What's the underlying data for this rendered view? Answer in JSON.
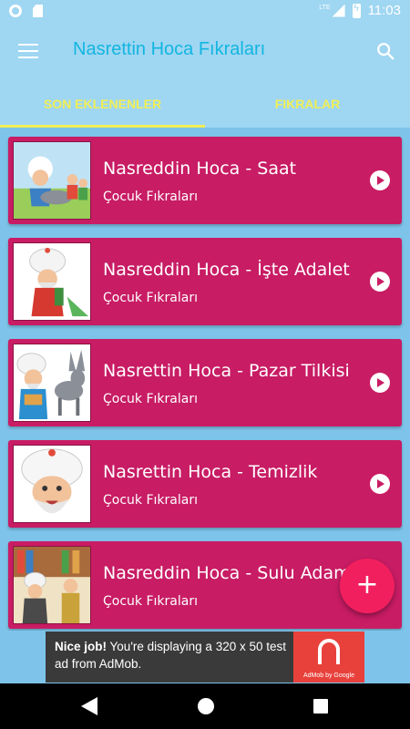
{
  "status_bar": {
    "network_label": "LTE",
    "time": "11:03"
  },
  "app_bar": {
    "title": "Nasrettin Hoca Fıkraları"
  },
  "tabs": [
    {
      "label": "SON EKLENENLER",
      "active": true
    },
    {
      "label": "FIKRALAR",
      "active": false
    }
  ],
  "items": [
    {
      "title": "Nasreddin Hoca - Saat",
      "category": "Çocuk Fıkraları"
    },
    {
      "title": "Nasreddin Hoca - İşte Adalet",
      "category": "Çocuk Fıkraları"
    },
    {
      "title": "Nasrettin Hoca - Pazar Tilkisi",
      "category": "Çocuk Fıkraları"
    },
    {
      "title": "Nasrettin Hoca - Temizlik",
      "category": "Çocuk Fıkraları"
    },
    {
      "title": "Nasreddin Hoca - Sulu Adam",
      "category": "Çocuk Fıkraları"
    }
  ],
  "fab": {
    "label": "+"
  },
  "ad": {
    "headline": "Nice job!",
    "body": "You're displaying a 320 x 50 test ad from AdMob.",
    "brand": "AdMob by Google"
  },
  "colors": {
    "app_bar": "#9fd6f2",
    "background": "#7ec4ea",
    "card": "#c81c64",
    "tab_accent": "#f0ef56",
    "title": "#12b6e0",
    "fab": "#f21f5f"
  },
  "icons": [
    "menu-icon",
    "search-icon",
    "play-icon",
    "add-icon",
    "back-icon",
    "home-icon",
    "recents-icon"
  ]
}
